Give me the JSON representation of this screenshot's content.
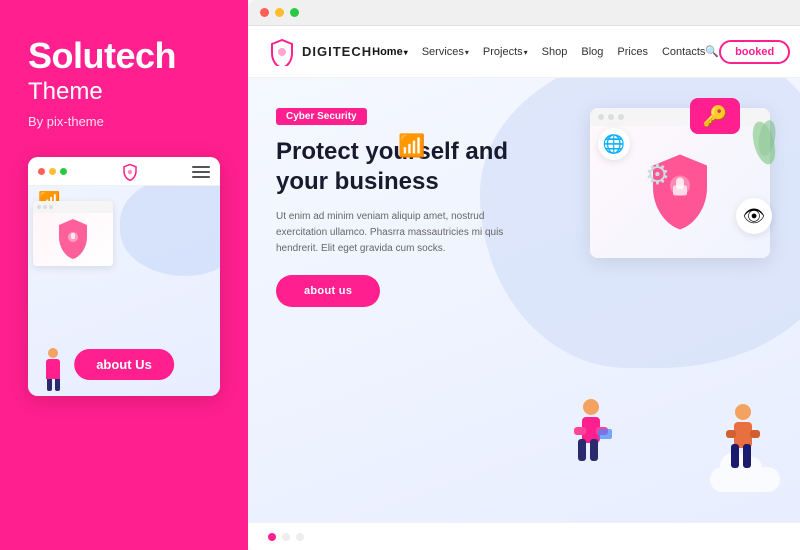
{
  "left": {
    "brand_title": "Solutech",
    "brand_subtitle": "Theme",
    "brand_by": "By pix-theme",
    "mobile_dots": [
      "red",
      "yellow",
      "green"
    ],
    "about_us_mobile": "about Us"
  },
  "browser": {
    "window_dots": [
      "red",
      "yellow",
      "green"
    ]
  },
  "header": {
    "logo_text": "DIGITECH",
    "nav_items": [
      "Home",
      "Services",
      "Projects",
      "Shop",
      "Blog",
      "Prices",
      "Contacts"
    ],
    "booked_label": "booked"
  },
  "hero": {
    "tag": "Cyber Security",
    "title_line1": "Protect yourself and",
    "title_line2": "your business",
    "body_text": "Ut enim ad minim veniam aliquip amet, nostrud exercitation ullamco. Phasrra massautricies mi quis hendrerit. Elit eget gravida cum socks.",
    "about_us_label": "about us",
    "icons": {
      "key": "🔑",
      "globe": "🌐",
      "gear": "⚙",
      "eye": "👁",
      "wifi": "📶"
    }
  },
  "colors": {
    "pink": "#FF1F8E",
    "dark": "#1a1a2e",
    "light_blue": "#d4dff8"
  }
}
